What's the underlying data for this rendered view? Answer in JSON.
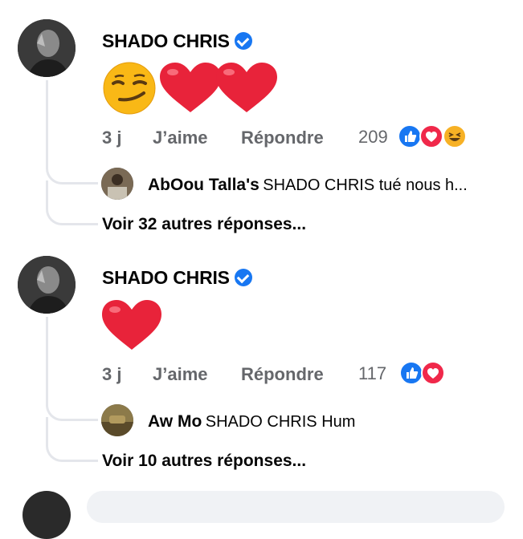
{
  "comments": [
    {
      "author": "SHADO CHRIS",
      "content_emojis": [
        "smirk-emoji",
        "red-heart-emoji",
        "red-heart-emoji"
      ],
      "time": "3 j",
      "like_label": "J’aime",
      "reply_label": "Répondre",
      "reaction_count": "209",
      "reactions": [
        "like",
        "love",
        "haha"
      ],
      "reply": {
        "author": "AbOou Talla's",
        "text": "SHADO CHRIS tué nous h..."
      },
      "more_replies": "Voir 32 autres réponses..."
    },
    {
      "author": "SHADO CHRIS",
      "content_emojis": [
        "red-heart-emoji"
      ],
      "time": "3 j",
      "like_label": "J’aime",
      "reply_label": "Répondre",
      "reaction_count": "117",
      "reactions": [
        "like",
        "love"
      ],
      "reply": {
        "author": "Aw Mo",
        "text": "SHADO CHRIS Hum"
      },
      "more_replies": "Voir 10 autres réponses..."
    }
  ],
  "colors": {
    "verified": "#1877f2",
    "like": "#1877f2",
    "love": "#f0284a",
    "haha": "#f7b125",
    "heart": "#e8233a"
  }
}
